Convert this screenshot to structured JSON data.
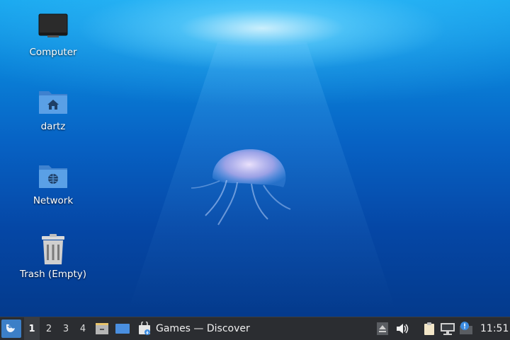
{
  "desktop": {
    "icons": [
      {
        "name": "computer",
        "label": "Computer",
        "icon": "monitor-icon"
      },
      {
        "name": "home",
        "label": "dartz",
        "icon": "home-folder-icon"
      },
      {
        "name": "network",
        "label": "Network",
        "icon": "network-folder-icon"
      },
      {
        "name": "trash",
        "label": "Trash (Empty)",
        "icon": "trash-icon"
      }
    ]
  },
  "panel": {
    "workspaces": [
      "1",
      "2",
      "3",
      "4"
    ],
    "active_workspace": "1",
    "task_title": "Games — Discover",
    "clock": "11:51",
    "colors": {
      "panel_bg": "#2b2d31",
      "menu_accent": "#3c7fc7",
      "folder": "#4a90d9"
    }
  }
}
